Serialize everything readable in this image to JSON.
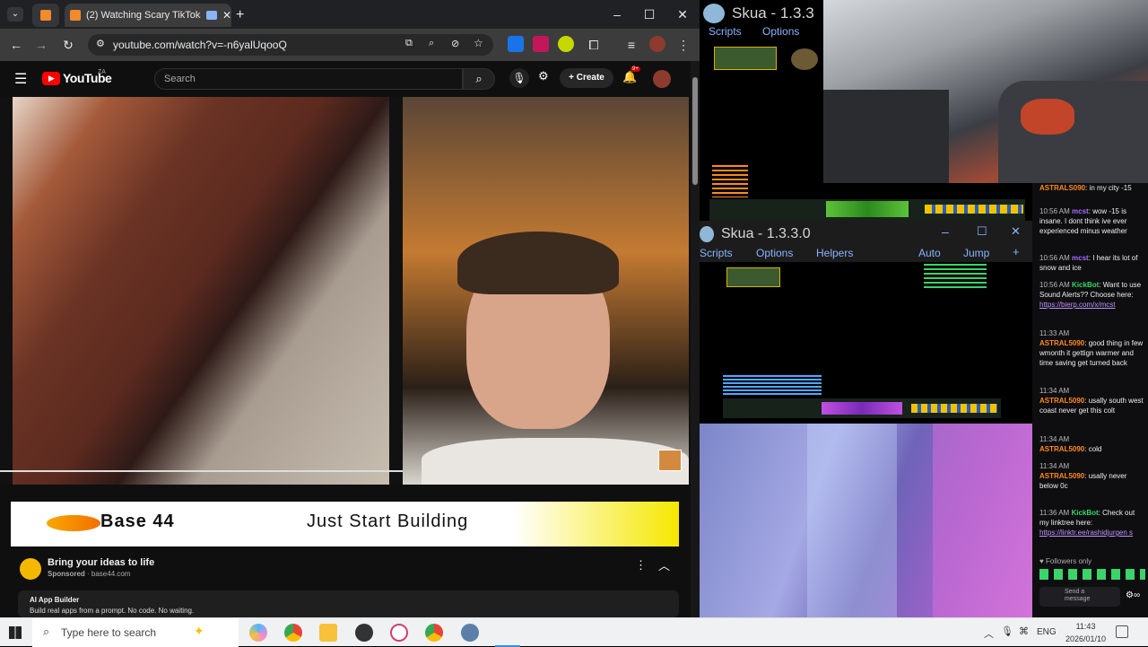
{
  "browser": {
    "tab_title": "(2) Watching Scary TikToks",
    "url": "youtube.com/watch?v=-n6yalUqooQ"
  },
  "youtube": {
    "logo_text": "YouTube",
    "logo_region": "ZA",
    "search_placeholder": "Search",
    "create_label": "Create",
    "notifications": "9+"
  },
  "ad": {
    "banner_brand": "Base 44",
    "banner_slogan": "Just Start Building",
    "headline": "Bring your ideas to life",
    "sponsored_label": "Sponsored",
    "domain": "base44.com",
    "sub_title": "AI App Builder",
    "sub_desc": "Build real apps from a prompt. No code. No waiting."
  },
  "skua": {
    "title": "Skua - 1.3.3.0",
    "title_short": "Skua - 1.3.3",
    "menu": [
      "Scripts",
      "Options",
      "Helpers"
    ],
    "right_menu": [
      "Auto",
      "Jump"
    ]
  },
  "chat": {
    "messages": [
      {
        "ts": "",
        "user": "ASTRALS090",
        "text": "in my city -15"
      },
      {
        "ts": "10:56 AM",
        "user": "mcst",
        "text": "wow -15 is insane. I dont think ive ever experienced minus weather"
      },
      {
        "ts": "10:56 AM",
        "user": "mcst",
        "text": "I hear its lot of snow and ice"
      },
      {
        "ts": "10:56 AM",
        "user": "KickBot",
        "text": "Want to use Sound Alerts?? Choose here:",
        "link": "https://bierp.com/x/mcst"
      },
      {
        "ts": "11:33 AM",
        "user": "ASTRAL5090",
        "text": "good thing in few wmonth it gettign warmer and time saving get turned back"
      },
      {
        "ts": "11:34 AM",
        "user": "ASTRAL5090",
        "text": "usally south west coast never get this colt"
      },
      {
        "ts": "11:34 AM",
        "user": "ASTRAL5090",
        "text": "cold"
      },
      {
        "ts": "11:34 AM",
        "user": "ASTRAL5090",
        "text": "usally never below 0c"
      },
      {
        "ts": "11:36 AM",
        "user": "KickBot",
        "text": "Check out my linktree here:",
        "link": "https://linktr.ee/rashidjurgen s"
      }
    ],
    "followers_only": "Followers only",
    "send_placeholder": "Send a message"
  },
  "taskbar": {
    "search_placeholder": "Type here to search",
    "lang": "ENG",
    "time": "11:43",
    "date": "2026/01/10"
  }
}
